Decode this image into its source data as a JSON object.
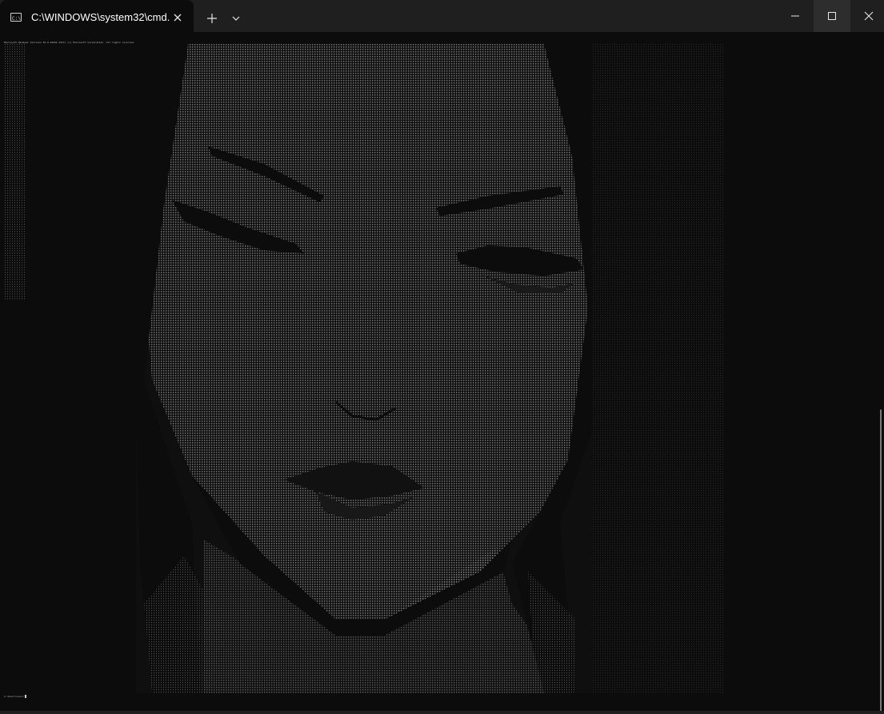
{
  "window": {
    "tab_title": "C:\\WINDOWS\\system32\\cmd.",
    "tab_icon": "terminal-icon",
    "new_tab_icon": "plus-icon",
    "dropdown_icon": "chevron-down-icon",
    "minimize_icon": "minimize-icon",
    "maximize_icon": "maximize-icon",
    "close_icon": "close-icon"
  },
  "terminal": {
    "header_text": "Microsoft Windows [Version 10.0.22631.4317] (c) Microsoft Corporation. All rights reserved.",
    "prompt_text": "C:\\Users\\user>",
    "content_icon": "ascii-art-portrait",
    "foreground_color": "#bdbdbd",
    "background_color": "#0c0c0c"
  },
  "colors": {
    "titlebar": "#1f1f1f",
    "active_tab": "#0c0c0c",
    "text": "#ffffff"
  }
}
